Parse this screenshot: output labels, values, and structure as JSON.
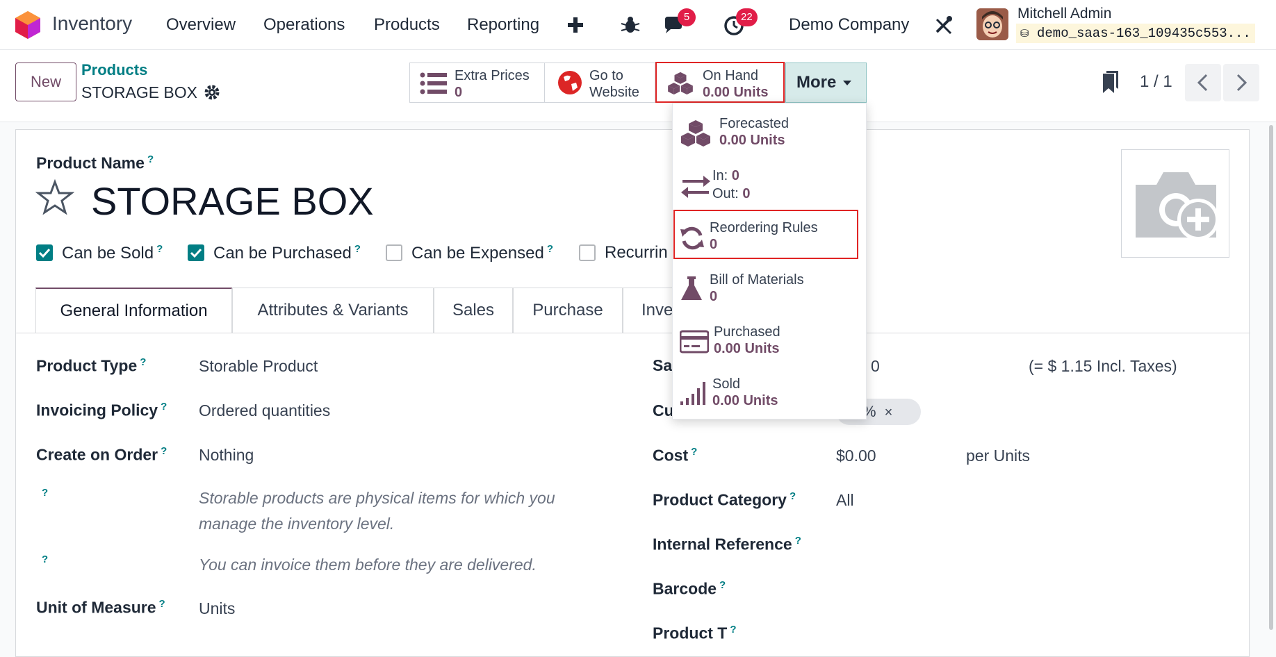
{
  "navbar": {
    "app_name": "Inventory",
    "menu": [
      "Overview",
      "Operations",
      "Products",
      "Reporting"
    ],
    "messages_count": "5",
    "activities_count": "22",
    "company": "Demo Company",
    "user_name": "Mitchell Admin",
    "db_name": "demo_saas-163_109435c553..."
  },
  "control": {
    "new_label": "New",
    "breadcrumb_parent": "Products",
    "breadcrumb_current": "STORAGE BOX",
    "smart_buttons": [
      {
        "label": "Extra Prices",
        "value": "0"
      },
      {
        "label": "Go to",
        "value": "Website"
      },
      {
        "label": "On Hand",
        "value": "0.00 Units"
      }
    ],
    "more_label": "More",
    "pager": "1 / 1"
  },
  "more_menu": [
    {
      "label": "Forecasted",
      "value": "0.00 Units"
    },
    {
      "label": "In: ",
      "value": "0",
      "label2": "Out: ",
      "value2": "0"
    },
    {
      "label": "Reordering Rules",
      "value": "0"
    },
    {
      "label": "Bill of Materials",
      "value": "0"
    },
    {
      "label": "Purchased",
      "value": "0.00 Units"
    },
    {
      "label": "Sold",
      "value": "0.00 Units"
    }
  ],
  "form": {
    "product_name_label": "Product Name",
    "product_name": "STORAGE BOX",
    "checkboxes": [
      {
        "label": "Can be Sold",
        "checked": true
      },
      {
        "label": "Can be Purchased",
        "checked": true
      },
      {
        "label": "Can be Expensed",
        "checked": false
      },
      {
        "label": "Recurrin",
        "checked": false
      }
    ],
    "tabs": [
      "General Information",
      "Attributes & Variants",
      "Sales",
      "Purchase",
      "Inve"
    ],
    "left_fields": [
      {
        "label": "Product Type",
        "value": "Storable Product"
      },
      {
        "label": "Invoicing Policy",
        "value": "Ordered quantities"
      },
      {
        "label": "Create on Order",
        "value": "Nothing"
      },
      {
        "label": "Unit of Measure",
        "value": "Units"
      }
    ],
    "help_1": "Storable products are physical items for which you manage the inventory level.",
    "help_2": "You can invoice them before they are delivered.",
    "right_fields": {
      "sales_price_label": "Sal",
      "sales_price_value": "0",
      "sales_price_incl": "(= $ 1.15 Incl. Taxes)",
      "customer_taxes_label": "Cu",
      "tax_tag": "%",
      "cost_label": "Cost",
      "cost_value": "$0.00",
      "cost_unit": "per Units",
      "category_label": "Product Category",
      "category_value": "All",
      "internal_ref_label": "Internal Reference",
      "barcode_label": "Barcode",
      "product_tags_label": "Product T"
    }
  },
  "colors": {
    "brand": "#714b67",
    "teal": "#017e84",
    "highlight": "#e02424",
    "badge": "#e11d48"
  }
}
